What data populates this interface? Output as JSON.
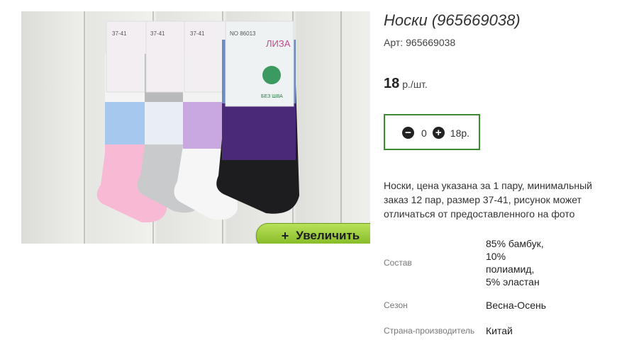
{
  "product": {
    "title": "Носки (965669038)",
    "article_label": "Арт:",
    "article": "965669038",
    "price": "18",
    "price_unit": "р./шт.",
    "description": "Носки, цена указана за 1 пару, минимальный заказ 12 пар, размер 37-41, рисунок может отличаться от предоставленного на фото"
  },
  "cart": {
    "quantity": "0",
    "total": "18р."
  },
  "image": {
    "zoom_label": "Увеличить",
    "zoom_plus": "+",
    "sock_tags": [
      "37-41",
      "37-41",
      "37-41",
      "NO 86013"
    ],
    "brand_text": "ЛИЗА",
    "badge_text": "БЕЗ ШВА"
  },
  "properties": [
    {
      "key": "Состав",
      "value": "85% бамбук, 10% полиамид, 5% эластан"
    },
    {
      "key": "Сезон",
      "value": "Весна-Осень"
    },
    {
      "key": "Страна-производитель",
      "value": "Китай"
    }
  ],
  "colors": {
    "cart_border": "#3a8c2e",
    "zoom_button": "#8fc52a"
  }
}
